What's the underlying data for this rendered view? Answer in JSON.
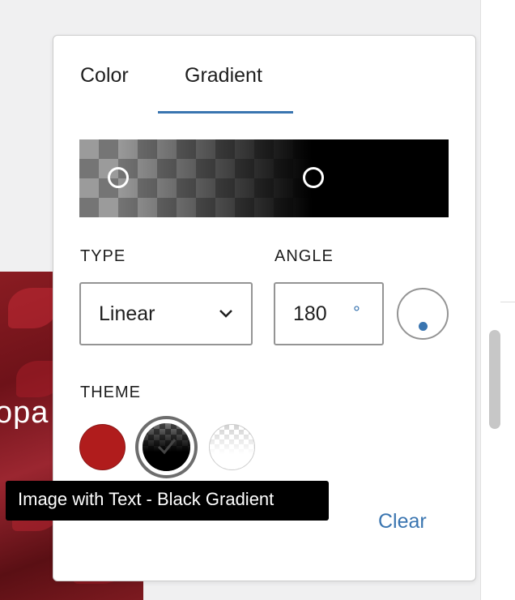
{
  "background": {
    "partial_text": "opa"
  },
  "popover": {
    "tabs": [
      {
        "label": "Color",
        "active": false
      },
      {
        "label": "Gradient",
        "active": true
      }
    ],
    "gradient": {
      "stops": [
        {
          "color": "rgba(0,0,0,0.18)",
          "position_percent": 10
        },
        {
          "color": "#000000",
          "position_percent": 63
        }
      ]
    },
    "type_label": "TYPE",
    "type_value": "Linear",
    "angle_label": "ANGLE",
    "angle_value": "180",
    "angle_unit": "°",
    "theme_label": "THEME",
    "theme_swatches": [
      {
        "name": "Red",
        "color": "#b01c1c",
        "selected": false
      },
      {
        "name": "Image with Text - Black Gradient",
        "selected": true
      },
      {
        "name": "White Gradient",
        "selected": false
      }
    ],
    "clear_label": "Clear"
  },
  "tooltip": {
    "text": "Image with Text - Black Gradient"
  },
  "colors": {
    "accent": "#3a75b0",
    "text": "#1e1e1e",
    "border": "#949494"
  }
}
